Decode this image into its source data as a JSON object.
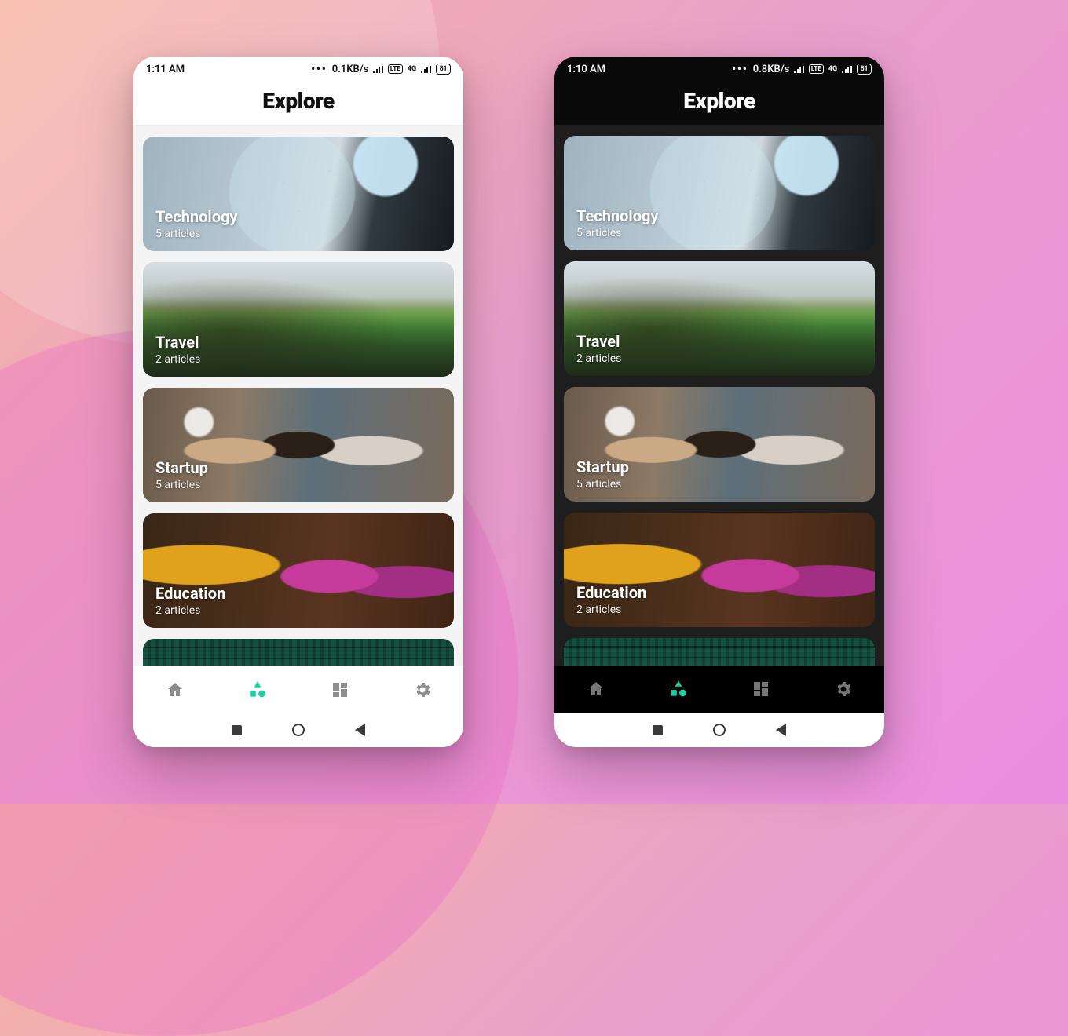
{
  "accent": "#17d1a4",
  "light": {
    "status": {
      "time": "1:11 AM",
      "net_rate": "0.1KB/s",
      "lte": "LTE",
      "net_gen": "4G",
      "battery": "81"
    },
    "title": "Explore",
    "cards": [
      {
        "title": "Technology",
        "sub": "5 articles"
      },
      {
        "title": "Travel",
        "sub": "2 articles"
      },
      {
        "title": "Startup",
        "sub": "5 articles"
      },
      {
        "title": "Education",
        "sub": "2 articles"
      }
    ],
    "nav": {
      "home": "Home",
      "explore": "Explore",
      "dashboard": "Dashboard",
      "settings": "Settings",
      "active_index": 1
    }
  },
  "dark": {
    "status": {
      "time": "1:10 AM",
      "net_rate": "0.8KB/s",
      "lte": "LTE",
      "net_gen": "4G",
      "battery": "81"
    },
    "title": "Explore",
    "cards": [
      {
        "title": "Technology",
        "sub": "5 articles"
      },
      {
        "title": "Travel",
        "sub": "2 articles"
      },
      {
        "title": "Startup",
        "sub": "5 articles"
      },
      {
        "title": "Education",
        "sub": "2 articles"
      }
    ],
    "nav": {
      "home": "Home",
      "explore": "Explore",
      "dashboard": "Dashboard",
      "settings": "Settings",
      "active_index": 1
    }
  }
}
